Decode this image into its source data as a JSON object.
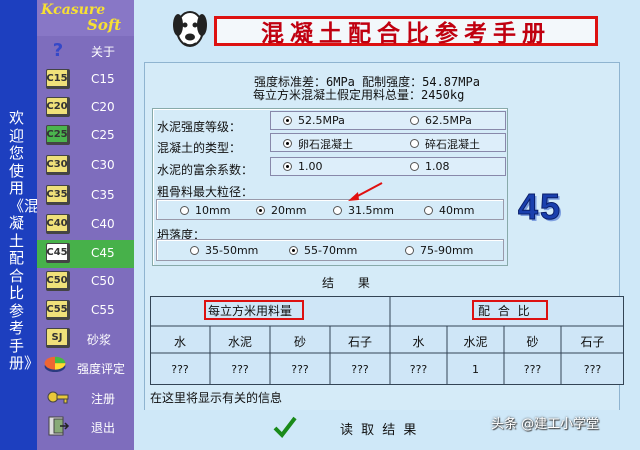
{
  "vertical_banner": "欢迎您使用《混凝土配合比参考手册》！",
  "logo": {
    "line1": "Kcasure",
    "line2": "Soft"
  },
  "title": "混凝土配合比参考手册",
  "info": {
    "line1": "强度标准差：6MPa 配制强度：54.87MPa",
    "line2": "每立方米混凝土假定用料总量：2450kg"
  },
  "nav": [
    {
      "icon_text": "?",
      "label": "关于",
      "icon": "question-icon"
    },
    {
      "icon_text": "C15",
      "label": "C15",
      "icon": "grade-chip-icon"
    },
    {
      "icon_text": "C20",
      "label": "C20",
      "icon": "grade-chip-icon"
    },
    {
      "icon_text": "C25",
      "label": "C25",
      "icon": "grade-chip-icon"
    },
    {
      "icon_text": "C30",
      "label": "C30",
      "icon": "grade-chip-icon"
    },
    {
      "icon_text": "C35",
      "label": "C35",
      "icon": "grade-chip-icon"
    },
    {
      "icon_text": "C40",
      "label": "C40",
      "icon": "grade-chip-icon"
    },
    {
      "icon_text": "C45",
      "label": "C45",
      "icon": "grade-chip-icon",
      "active": true
    },
    {
      "icon_text": "C50",
      "label": "C50",
      "icon": "grade-chip-icon"
    },
    {
      "icon_text": "C55",
      "label": "C55",
      "icon": "grade-chip-icon"
    },
    {
      "icon_text": "SJ",
      "label": "砂浆",
      "icon": "mortar-chip-icon"
    },
    {
      "icon_text": "",
      "label": "强度评定",
      "icon": "pie-chart-icon"
    },
    {
      "icon_text": "",
      "label": "注册",
      "icon": "key-icon"
    },
    {
      "icon_text": "",
      "label": "退出",
      "icon": "exit-icon"
    }
  ],
  "params": {
    "cement_grade": {
      "label": "水泥强度等级：",
      "options": [
        "52.5MPa",
        "62.5MPa"
      ],
      "selected": "52.5MPa"
    },
    "concrete_type": {
      "label": "混凝土的类型：",
      "options": [
        "卵石混凝土",
        "碎石混凝土"
      ],
      "selected": "卵石混凝土"
    },
    "cement_factor": {
      "label": "水泥的富余系数：",
      "options": [
        "1.00",
        "1.08"
      ],
      "selected": "1.00"
    },
    "aggregate": {
      "label": "粗骨料最大粒径：",
      "options": [
        "10mm",
        "20mm",
        "31.5mm",
        "40mm"
      ],
      "selected": "20mm"
    },
    "slump": {
      "label": "坍落度：",
      "options": [
        "35-50mm",
        "55-70mm",
        "75-90mm"
      ],
      "selected": "55-70mm"
    }
  },
  "grade_display": "45",
  "results": {
    "title": "结 果",
    "left_header": "每立方米用料量",
    "right_header": "配 合 比",
    "columns": [
      "水",
      "水泥",
      "砂",
      "石子",
      "水",
      "水泥",
      "砂",
      "石子"
    ],
    "values": [
      "???",
      "???",
      "???",
      "???",
      "???",
      "1",
      "???",
      "???"
    ]
  },
  "hint": "在这里将显示有关的信息",
  "read_button": {
    "label": "读 取 结 果"
  },
  "watermark": "头条 @建工小学堂",
  "colors": {
    "title_red": "#c00010",
    "sidebar": "#7e6dbd",
    "active_green": "#47b14a",
    "digits_blue": "#1a3fae"
  }
}
